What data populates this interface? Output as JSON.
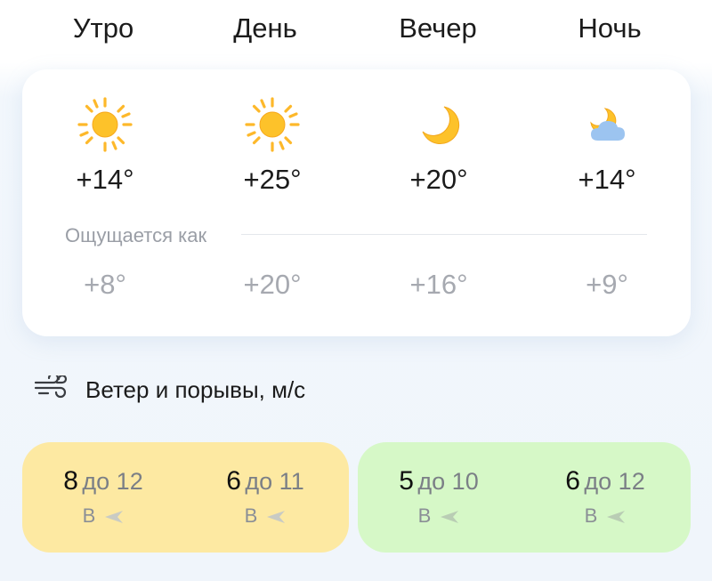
{
  "periods": [
    {
      "label": "Утро",
      "icon": "sun-icon",
      "temp": "+14°",
      "feels": "+8°"
    },
    {
      "label": "День",
      "icon": "sun-icon",
      "temp": "+25°",
      "feels": "+20°"
    },
    {
      "label": "Вечер",
      "icon": "moon-icon",
      "temp": "+20°",
      "feels": "+16°"
    },
    {
      "label": "Ночь",
      "icon": "moon-cloud-icon",
      "temp": "+14°",
      "feels": "+9°"
    }
  ],
  "feels_label": "Ощущается как",
  "wind": {
    "title": "Ветер и порывы, м/с",
    "icon": "wind-icon",
    "items": [
      {
        "speed": "8",
        "gust": "до 12",
        "dir": "В"
      },
      {
        "speed": "6",
        "gust": "до 11",
        "dir": "В"
      },
      {
        "speed": "5",
        "gust": "до 10",
        "dir": "В"
      },
      {
        "speed": "6",
        "gust": "до 12",
        "dir": "В"
      }
    ]
  },
  "colors": {
    "sun": "#fdc82f",
    "sun_glow": "#ffb300",
    "cloud": "#9cc4f0",
    "wind_calm_bg": "#d6f8c7",
    "wind_moderate_bg": "#fde9a2"
  }
}
